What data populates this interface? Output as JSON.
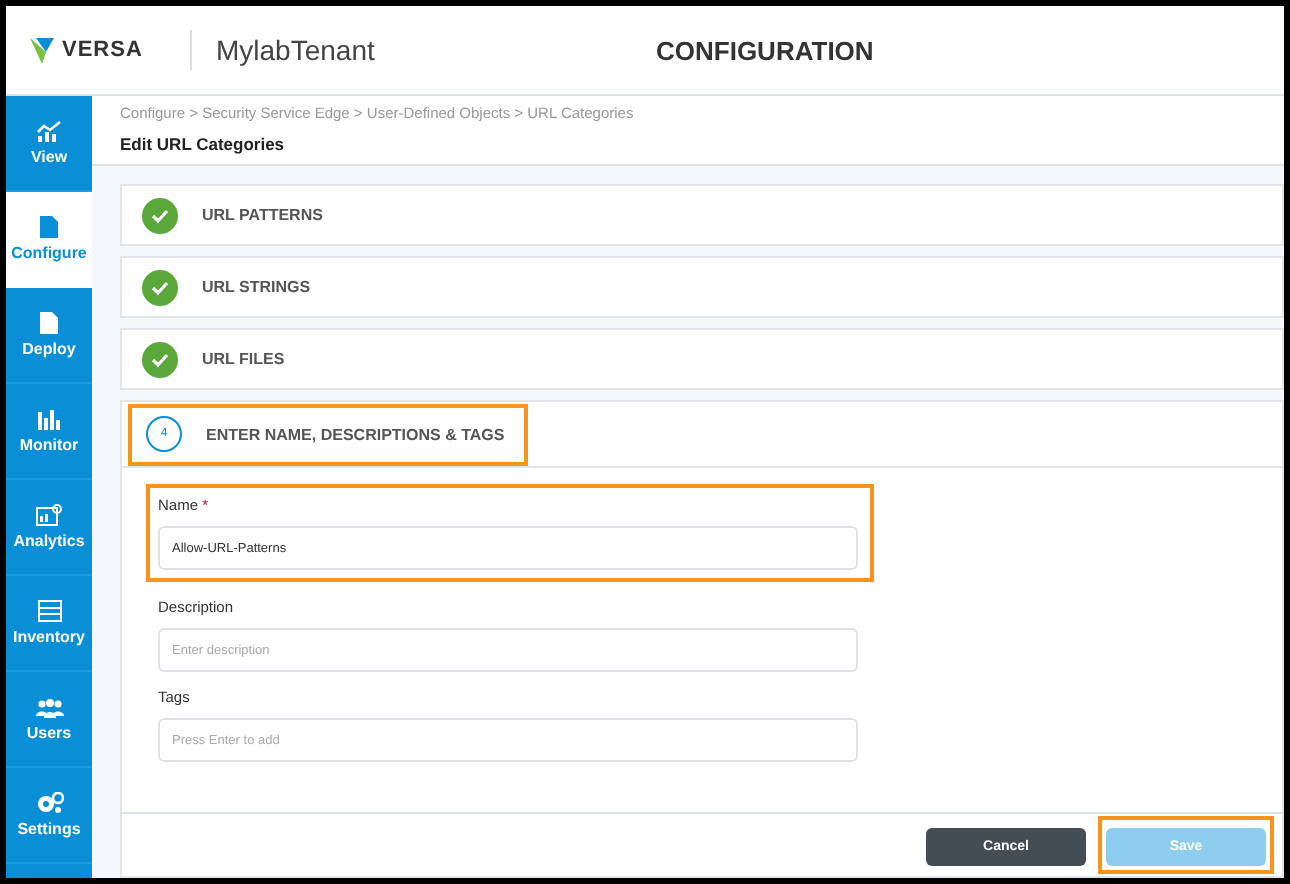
{
  "header": {
    "brand": "VERSA",
    "tenant": "MylabTenant",
    "title": "CONFIGURATION"
  },
  "sidebar": {
    "items": [
      {
        "label": "View",
        "selected": false
      },
      {
        "label": "Configure",
        "selected": true
      },
      {
        "label": "Deploy",
        "selected": false
      },
      {
        "label": "Monitor",
        "selected": false
      },
      {
        "label": "Analytics",
        "selected": false
      },
      {
        "label": "Inventory",
        "selected": false
      },
      {
        "label": "Users",
        "selected": false
      },
      {
        "label": "Settings",
        "selected": false
      }
    ]
  },
  "breadcrumb": "Configure > Security Service Edge > User-Defined Objects > URL Categories",
  "page_title": "Edit URL Categories",
  "steps": [
    {
      "label": "URL PATTERNS",
      "done": true,
      "highlighted": false
    },
    {
      "label": "URL STRINGS",
      "done": true,
      "highlighted": false
    },
    {
      "label": "URL FILES",
      "done": true,
      "highlighted": false
    },
    {
      "label": "ENTER NAME, DESCRIPTIONS & TAGS",
      "done": false,
      "number": "4",
      "highlighted": true
    }
  ],
  "fields": [
    {
      "label": "Name",
      "required_mark": "*",
      "value": "Allow-URL-Patterns",
      "highlighted": true
    },
    {
      "label": "Description",
      "placeholder": "Enter description",
      "highlighted": false
    },
    {
      "label": "Tags",
      "placeholder": "Press Enter to add",
      "highlighted": false
    }
  ],
  "buttons": [
    {
      "label": "Cancel",
      "kind": "secondary",
      "disabled": false,
      "highlighted": false
    },
    {
      "label": "Save",
      "kind": "primary",
      "disabled": true,
      "highlighted": true
    }
  ]
}
